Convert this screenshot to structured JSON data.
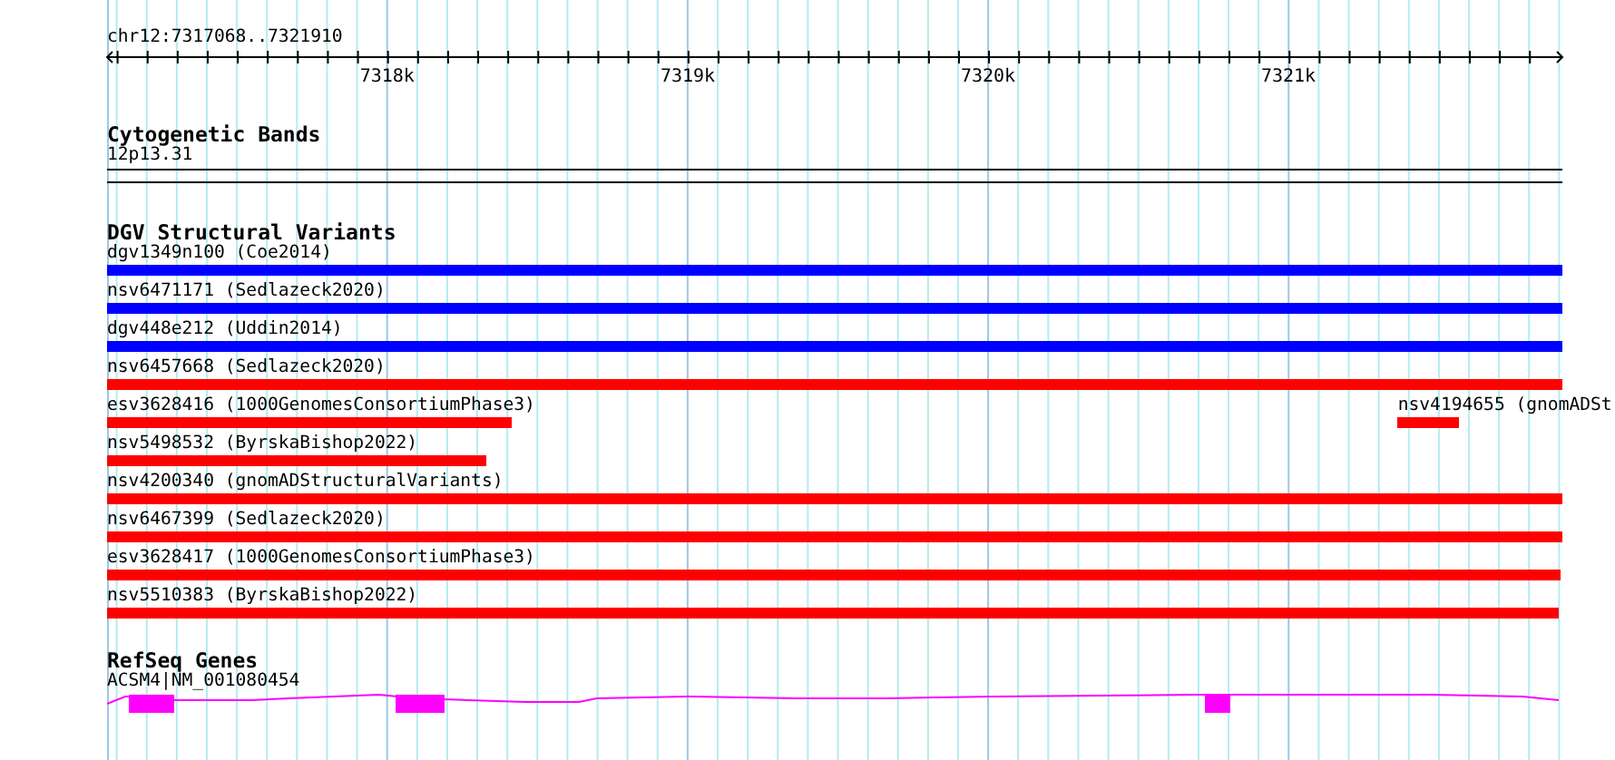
{
  "ruler": {
    "location": "chr12:7317068..7321910",
    "ticks": [
      "7318k",
      "7319k",
      "7320k",
      "7321k"
    ]
  },
  "cytogenetic_bands": {
    "title": "Cytogenetic Bands",
    "band": "12p13.31"
  },
  "dgv_structural_variants": {
    "title": "DGV Structural Variants",
    "rows": [
      {
        "features": [
          {
            "label": "dgv1349n100 (Coe2014)",
            "color": "#0000ff"
          }
        ]
      },
      {
        "features": [
          {
            "label": "nsv6471171 (Sedlazeck2020)",
            "color": "#0000ff"
          }
        ]
      },
      {
        "features": [
          {
            "label": "dgv448e212 (Uddin2014)",
            "color": "#0000ff"
          }
        ]
      },
      {
        "features": [
          {
            "label": "nsv6457668 (Sedlazeck2020)",
            "color": "#ff0000"
          }
        ]
      },
      {
        "features": [
          {
            "label": "esv3628416 (1000GenomesConsortiumPhase3)",
            "color": "#ff0000"
          },
          {
            "label": "nsv4194655 (gnomADSt",
            "color": "#ff0000"
          }
        ]
      },
      {
        "features": [
          {
            "label": "nsv5498532 (ByrskaBishop2022)",
            "color": "#ff0000"
          }
        ]
      },
      {
        "features": [
          {
            "label": "nsv4200340 (gnomADStructuralVariants)",
            "color": "#ff0000"
          }
        ]
      },
      {
        "features": [
          {
            "label": "nsv6467399 (Sedlazeck2020)",
            "color": "#ff0000"
          }
        ]
      },
      {
        "features": [
          {
            "label": "esv3628417 (1000GenomesConsortiumPhase3)",
            "color": "#ff0000"
          }
        ]
      },
      {
        "features": [
          {
            "label": "nsv5510383 (ByrskaBishop2022)",
            "color": "#ff0000"
          }
        ]
      }
    ]
  },
  "refseq_genes": {
    "title": "RefSeq Genes",
    "gene": "ACSM4|NM_001080454"
  }
}
